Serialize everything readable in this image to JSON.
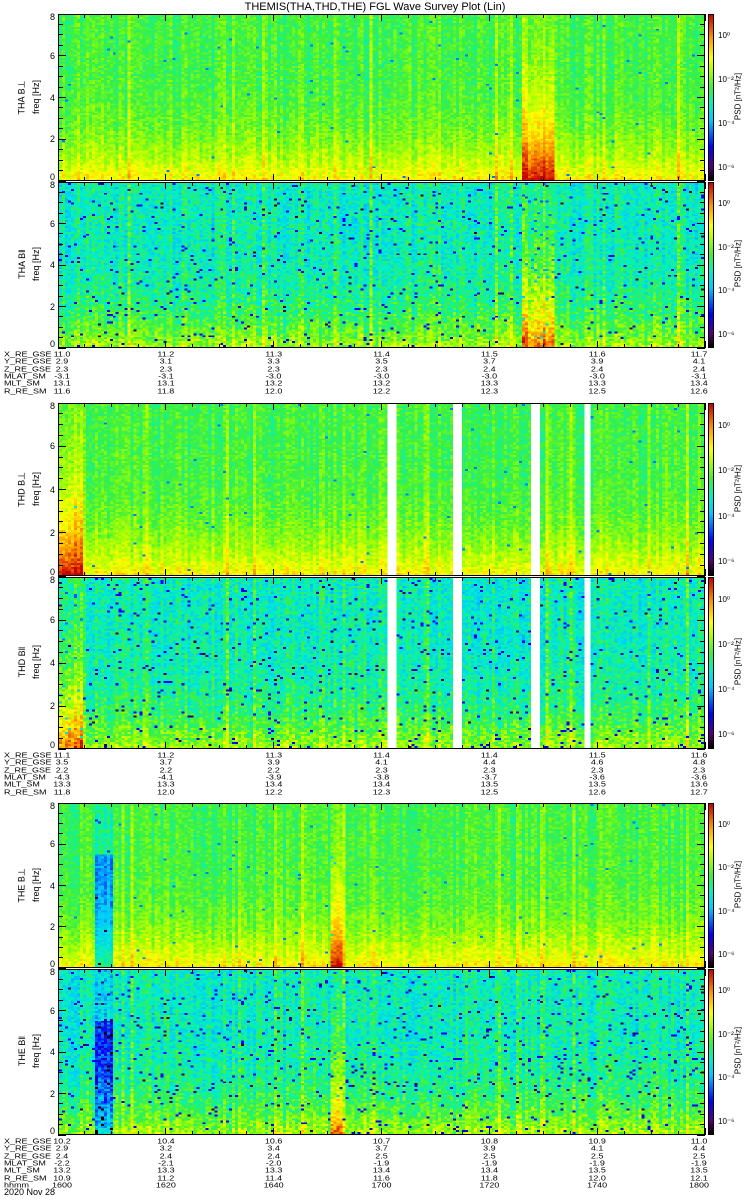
{
  "title": "THEMIS(THA,THD,THE) FGL Wave Survey Plot (Lin)",
  "date": "2020 Nov 28",
  "colors": {
    "axis": "#000000",
    "background": "#ffffff",
    "gap": "#ffffff"
  },
  "chart_data": {
    "type": "heatmap",
    "title": "THEMIS(THA,THD,THE) FGL Wave Survey Plot (Lin)",
    "xlabel": "hhmm",
    "x_ticks": [
      "1600",
      "1620",
      "1640",
      "1700",
      "1720",
      "1740",
      "1800"
    ],
    "xlim_minutes": [
      0,
      120
    ],
    "ylim": [
      0,
      8
    ],
    "y_ticks": [
      "0",
      "2",
      "4",
      "6",
      "8"
    ],
    "colorbar": {
      "label": "PSD [nT²/Hz]",
      "ticks": [
        {
          "exp": 0,
          "text": "10⁰"
        },
        {
          "exp": -2,
          "text": "10⁻²"
        },
        {
          "exp": -4,
          "text": "10⁻⁴"
        },
        {
          "exp": -6,
          "text": "10⁻⁶"
        }
      ],
      "zlim_log10": [
        -6.6,
        1.0
      ],
      "colormap": "rainbow"
    },
    "probes": [
      {
        "name": "THA",
        "panels": [
          {
            "label": "THA B⊥",
            "ylabel": "freq [Hz]",
            "component": "perp"
          },
          {
            "label": "THA B‖",
            "ylabel": "freq [Hz]",
            "component": "par"
          }
        ],
        "gaps_minutes": [],
        "enhancements_minutes": [
          [
            86,
            92,
            0.2
          ]
        ],
        "ephemeris": [
          {
            "name": "X_RE_GSE",
            "values": [
              "11.0",
              "11.2",
              "11.3",
              "11.4",
              "11.5",
              "11.6",
              "11.7"
            ]
          },
          {
            "name": "Y_RE_GSE",
            "values": [
              "2.9",
              "3.1",
              "3.3",
              "3.5",
              "3.7",
              "3.9",
              "4.1"
            ]
          },
          {
            "name": "Z_RE_GSE",
            "values": [
              "2.3",
              "2.3",
              "2.3",
              "2.3",
              "2.4",
              "2.4",
              "2.4"
            ]
          },
          {
            "name": "MLAT_SM",
            "values": [
              "-3.1",
              "-3.1",
              "-3.0",
              "-3.0",
              "-3.0",
              "-3.0",
              "-3.1"
            ]
          },
          {
            "name": "MLT_SM",
            "values": [
              "13.1",
              "13.1",
              "13.2",
              "13.2",
              "13.3",
              "13.3",
              "13.4"
            ]
          },
          {
            "name": "R_RE_SM",
            "values": [
              "11.6",
              "11.8",
              "12.0",
              "12.2",
              "12.3",
              "12.5",
              "12.6"
            ]
          }
        ]
      },
      {
        "name": "THD",
        "panels": [
          {
            "label": "THD B⊥",
            "ylabel": "freq [Hz]",
            "component": "perp"
          },
          {
            "label": "THD B‖",
            "ylabel": "freq [Hz]",
            "component": "par"
          }
        ],
        "gaps_minutes": [
          [
            61.0,
            62.5
          ],
          [
            73.0,
            74.5
          ],
          [
            87.7,
            89.2
          ],
          [
            97.3,
            98.8
          ]
        ],
        "enhancements_minutes": [
          [
            0,
            4,
            0.2
          ]
        ],
        "ephemeris": [
          {
            "name": "X_RE_GSE",
            "values": [
              "11.1",
              "11.2",
              "11.3",
              "11.4",
              "11.4",
              "11.5",
              "11.6"
            ]
          },
          {
            "name": "Y_RE_GSE",
            "values": [
              "3.5",
              "3.7",
              "3.9",
              "4.1",
              "4.4",
              "4.6",
              "4.8"
            ]
          },
          {
            "name": "Z_RE_GSE",
            "values": [
              "2.2",
              "2.2",
              "2.2",
              "2.3",
              "2.3",
              "2.3",
              "2.3"
            ]
          },
          {
            "name": "MLAT_SM",
            "values": [
              "-4.3",
              "-4.1",
              "-3.9",
              "-3.8",
              "-3.7",
              "-3.6",
              "-3.6"
            ]
          },
          {
            "name": "MLT_SM",
            "values": [
              "13.3",
              "13.3",
              "13.4",
              "13.4",
              "13.5",
              "13.5",
              "13.6"
            ]
          },
          {
            "name": "R_RE_SM",
            "values": [
              "11.8",
              "12.0",
              "12.2",
              "12.3",
              "12.5",
              "12.6",
              "12.7"
            ]
          }
        ]
      },
      {
        "name": "THE",
        "panels": [
          {
            "label": "THE B⊥",
            "ylabel": "freq [Hz]",
            "component": "perp"
          },
          {
            "label": "THE B‖",
            "ylabel": "freq [Hz]",
            "component": "par"
          }
        ],
        "gaps_minutes": [],
        "enhancements_minutes": [
          [
            50.5,
            52.5,
            0.2
          ],
          [
            6.5,
            9.5,
            -0.25
          ]
        ],
        "ephemeris": [
          {
            "name": "X_RE_GSE",
            "values": [
              "10.2",
              "10.4",
              "10.6",
              "10.7",
              "10.8",
              "10.9",
              "11.0"
            ]
          },
          {
            "name": "Y_RE_GSE",
            "values": [
              "2.9",
              "3.2",
              "3.4",
              "3.7",
              "3.9",
              "4.1",
              "4.4"
            ]
          },
          {
            "name": "Z_RE_GSE",
            "values": [
              "2.4",
              "2.4",
              "2.4",
              "2.5",
              "2.5",
              "2.5",
              "2.5"
            ]
          },
          {
            "name": "MLAT_SM",
            "values": [
              "-2.2",
              "-2.1",
              "-2.0",
              "-1.9",
              "-1.9",
              "-1.9",
              "-1.9"
            ]
          },
          {
            "name": "MLT_SM",
            "values": [
              "13.2",
              "13.3",
              "13.3",
              "13.4",
              "13.4",
              "13.5",
              "13.5"
            ]
          },
          {
            "name": "R_RE_SM",
            "values": [
              "10.9",
              "11.2",
              "11.4",
              "11.6",
              "11.8",
              "12.0",
              "12.1"
            ]
          },
          {
            "name": "hhmm",
            "values": [
              "1600",
              "1620",
              "1640",
              "1700",
              "1720",
              "1740",
              "1800"
            ]
          }
        ]
      }
    ]
  }
}
